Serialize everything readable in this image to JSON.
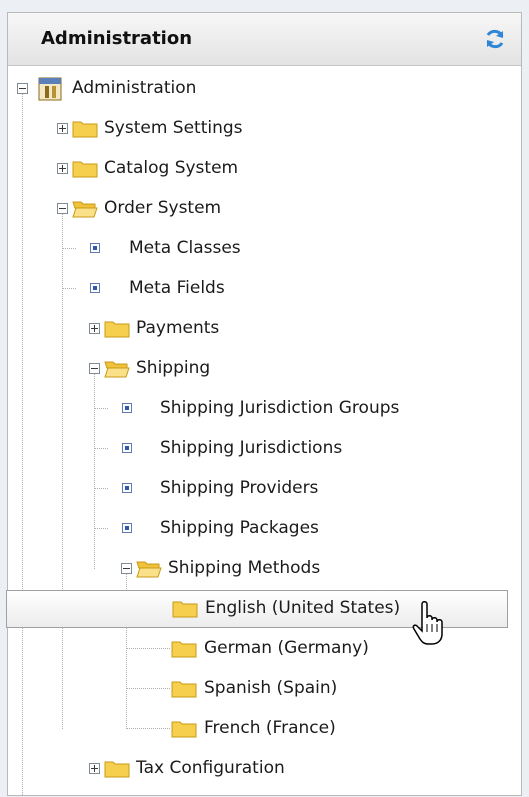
{
  "panel": {
    "title": "Administration"
  },
  "tree": [
    {
      "label": "Administration",
      "icon": "admin-icon",
      "toggle": "minus"
    },
    {
      "label": "System Settings",
      "icon": "folder-icon",
      "toggle": "plus"
    },
    {
      "label": "Catalog System",
      "icon": "folder-icon",
      "toggle": "plus"
    },
    {
      "label": "Order System",
      "icon": "folder-open-icon",
      "toggle": "minus"
    },
    {
      "label": "Meta Classes",
      "icon": "leaf-node-icon"
    },
    {
      "label": "Meta Fields",
      "icon": "leaf-node-icon"
    },
    {
      "label": "Payments",
      "icon": "folder-icon",
      "toggle": "plus"
    },
    {
      "label": "Shipping",
      "icon": "folder-open-icon",
      "toggle": "minus"
    },
    {
      "label": "Shipping Jurisdiction Groups",
      "icon": "leaf-node-icon"
    },
    {
      "label": "Shipping Jurisdictions",
      "icon": "leaf-node-icon"
    },
    {
      "label": "Shipping Providers",
      "icon": "leaf-node-icon"
    },
    {
      "label": "Shipping Packages",
      "icon": "leaf-node-icon"
    },
    {
      "label": "Shipping Methods",
      "icon": "folder-open-icon",
      "toggle": "minus"
    },
    {
      "label": "English (United States)",
      "icon": "folder-icon",
      "selected": true
    },
    {
      "label": "German (Germany)",
      "icon": "folder-icon"
    },
    {
      "label": "Spanish (Spain)",
      "icon": "folder-icon"
    },
    {
      "label": "French (France)",
      "icon": "folder-icon"
    },
    {
      "label": "Tax Configuration",
      "icon": "folder-icon",
      "toggle": "plus"
    }
  ],
  "colors": {
    "folder": "#f6cf4e",
    "folder_edge": "#c89a16",
    "selection_border": "#9ea0a3",
    "leaf": "#2e58a8"
  }
}
